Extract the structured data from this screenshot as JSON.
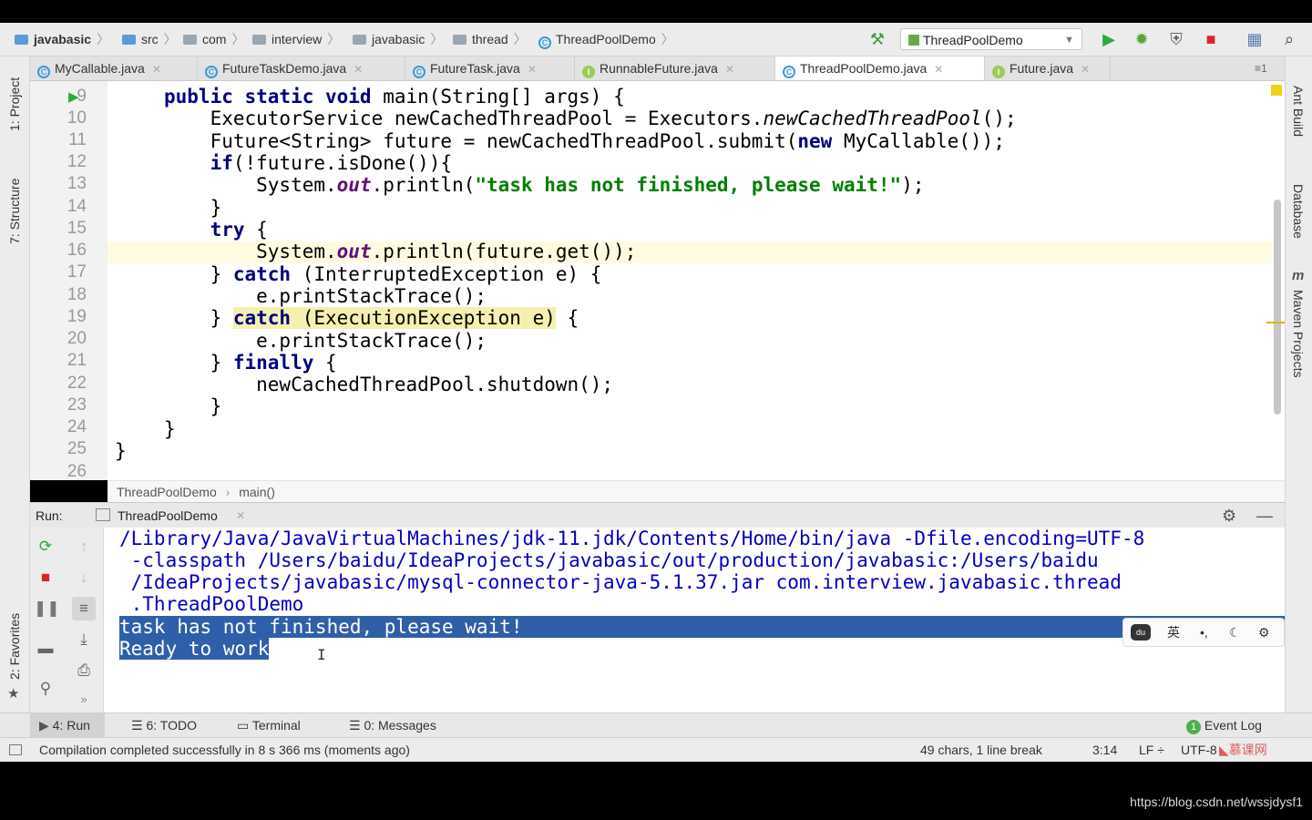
{
  "navbar": {
    "crumbs": [
      "javabasic",
      "src",
      "com",
      "interview",
      "javabasic",
      "thread",
      "ThreadPoolDemo"
    ],
    "run_config": "ThreadPoolDemo"
  },
  "tabs": [
    {
      "label": "MyCallable.java",
      "kind": "C"
    },
    {
      "label": "FutureTaskDemo.java",
      "kind": "C"
    },
    {
      "label": "FutureTask.java",
      "kind": "C"
    },
    {
      "label": "RunnableFuture.java",
      "kind": "I"
    },
    {
      "label": "ThreadPoolDemo.java",
      "kind": "C",
      "active": true
    },
    {
      "label": "Future.java",
      "kind": "I"
    }
  ],
  "tabs_overflow": "≡1",
  "left_strip": {
    "project": "1: Project",
    "structure": "7: Structure",
    "favorites": "2: Favorites"
  },
  "right_strip": {
    "ant": "Ant Build",
    "database": "Database",
    "maven": "Maven Projects"
  },
  "editor": {
    "line_numbers": [
      "9",
      "10",
      "11",
      "12",
      "13",
      "14",
      "15",
      "16",
      "17",
      "18",
      "19",
      "20",
      "21",
      "22",
      "23",
      "24",
      "25",
      "26"
    ],
    "breadcrumb": [
      "ThreadPoolDemo",
      "main()"
    ]
  },
  "run": {
    "label": "Run:",
    "tab": "ThreadPoolDemo",
    "console": [
      "/Library/Java/JavaVirtualMachines/jdk-11.jdk/Contents/Home/bin/java -Dfile.encoding=UTF-8",
      " -classpath /Users/baidu/IdeaProjects/javabasic/out/production/javabasic:/Users/baidu",
      " /IdeaProjects/javabasic/mysql-connector-java-5.1.37.jar com.interview.javabasic.thread",
      " .ThreadPoolDemo",
      "task has not finished, please wait!",
      "Ready to work"
    ],
    "ime": {
      "lang": "英",
      "punct": "•,"
    }
  },
  "bottom_bar": {
    "run": "4: Run",
    "todo": "6: TODO",
    "terminal": "Terminal",
    "messages": "0: Messages",
    "event_log": "Event Log",
    "event_count": "1"
  },
  "status": {
    "message": "Compilation completed successfully in 8 s 366 ms (moments ago)",
    "selection": "49 chars, 1 line break",
    "position": "3:14",
    "line_sep": "LF ÷",
    "encoding": "UTF-8"
  },
  "watermark": "https://blog.csdn.net/wssjdysf1",
  "colors": {
    "keyword": "#000080",
    "string": "#008000",
    "console": "#0000c0",
    "selection": "#2f5fa8"
  }
}
